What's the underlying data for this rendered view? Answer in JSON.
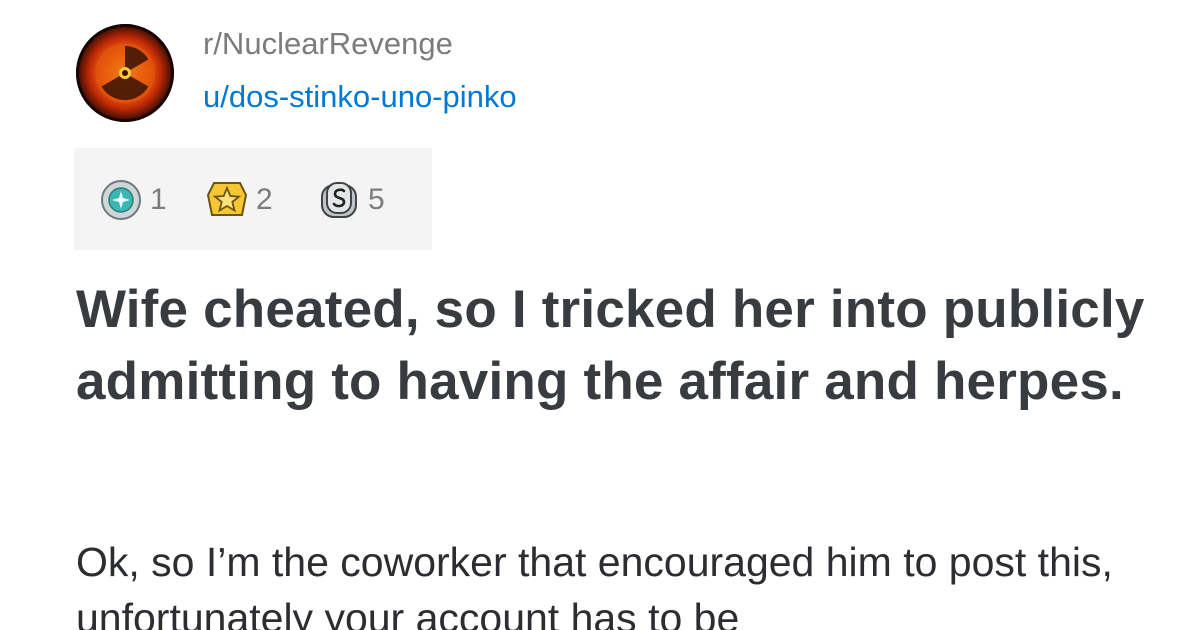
{
  "post": {
    "subreddit": "r/NuclearRevenge",
    "username": "u/dos-stinko-uno-pinko",
    "avatar_icon": "nuclear-fire-avatar",
    "awards": [
      {
        "icon": "platinum-award-icon",
        "count": "1"
      },
      {
        "icon": "gold-award-icon",
        "count": "2"
      },
      {
        "icon": "silver-award-icon",
        "count": "5"
      }
    ],
    "title": "Wife cheated, so I tricked her into publicly admitting to having the affair and herpes.",
    "body": "Ok, so I’m the coworker that encouraged him to post this, unfortunately your account has to be"
  },
  "colors": {
    "subreddit": "#7c7c7c",
    "username_link": "#0079d3",
    "title": "#383c40",
    "award_bar_bg": "#f4f4f4"
  }
}
